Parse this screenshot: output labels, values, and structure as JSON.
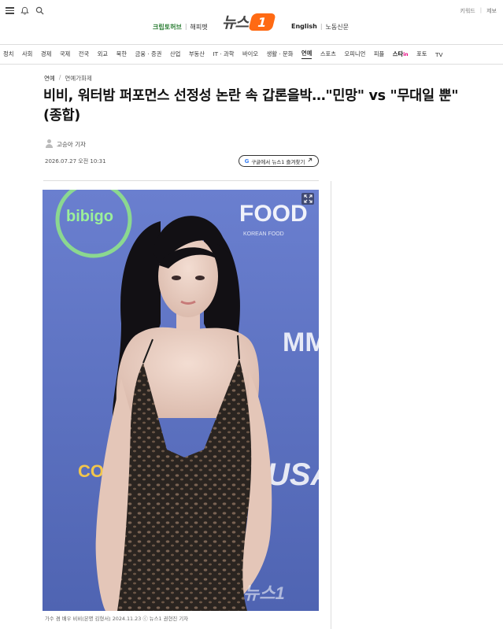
{
  "header": {
    "top_right": [
      "키워드",
      "제보"
    ],
    "partners_left": [
      "크립토허브",
      "해피펫"
    ],
    "logo_text": "뉴스",
    "logo_badge": "1",
    "partners_right": [
      "English",
      "노동신문"
    ]
  },
  "nav": {
    "items": [
      "정치",
      "사회",
      "경제",
      "국제",
      "전국",
      "외교",
      "북한",
      "금융 · 증권",
      "산업",
      "부동산",
      "IT · 과학",
      "바이오",
      "생활 · 문화",
      "연예",
      "스포츠",
      "오피니언",
      "피플"
    ],
    "star_label": "스타",
    "star_badge": "in",
    "extra": [
      "포토",
      "TV"
    ],
    "active": "연예"
  },
  "article": {
    "breadcrumb": [
      "연예",
      "연예가화제"
    ],
    "title": "비비, 워터밤 퍼포먼스 선정성 논란 속 갑론을박…\"민망\" vs \"무대일 뿐\"(종합)",
    "reporter": "고승아 기자",
    "date": "2026.07.27 오전 10:31",
    "google_button": "구글에서 뉴스1 즐겨찾기",
    "photo_backdrop_texts": [
      "bibigo",
      "FOOD",
      "KOREAN FOOD",
      "MMA",
      "COM",
      "USA"
    ],
    "photo_watermark": "뉴스1",
    "caption": "가수 겸 배우 비비(본명 김형서) 2024.11.23 ⓒ 뉴스1 권현진 기자"
  },
  "colors": {
    "brand_orange": "#ff6a13",
    "partner_green": "#2a7d33",
    "backdrop_blue": "#5d71c0"
  },
  "icons": [
    "menu-icon",
    "bell-icon",
    "search-icon",
    "reporter-avatar-icon",
    "google-g-icon",
    "external-link-icon",
    "expand-icon"
  ]
}
